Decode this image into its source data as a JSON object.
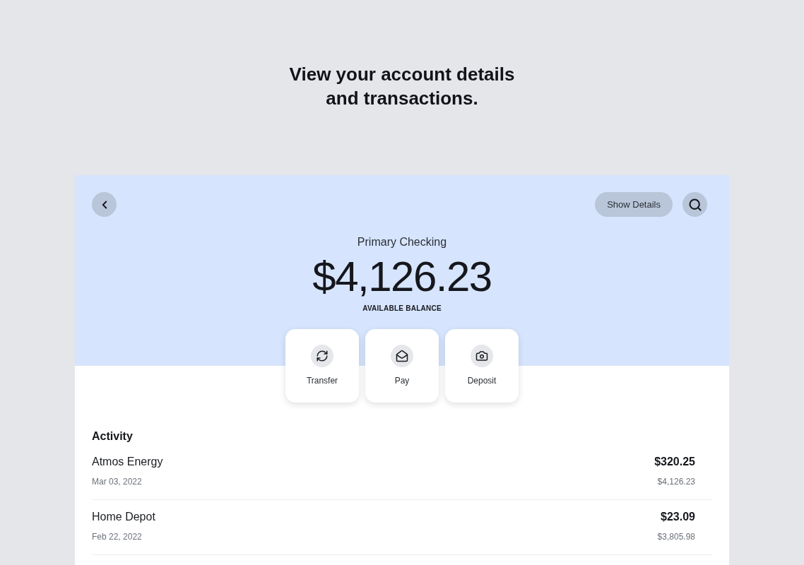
{
  "headline": [
    "View your account details",
    "and transactions."
  ],
  "header": {
    "show_details": "Show Details"
  },
  "account": {
    "name": "Primary Checking",
    "balance": "$4,126.23",
    "balance_label": "AVAILABLE BALANCE"
  },
  "actions": [
    {
      "kind": "transfer",
      "label": "Transfer"
    },
    {
      "kind": "pay",
      "label": "Pay"
    },
    {
      "kind": "deposit",
      "label": "Deposit"
    }
  ],
  "activity": {
    "title": "Activity",
    "transactions": [
      {
        "payee": "Atmos Energy",
        "date": "Mar 03, 2022",
        "amount": "$320.25",
        "balance": "$4,126.23"
      },
      {
        "payee": "Home Depot",
        "date": "Feb 22, 2022",
        "amount": "$23.09",
        "balance": "$3,805.98"
      }
    ]
  }
}
